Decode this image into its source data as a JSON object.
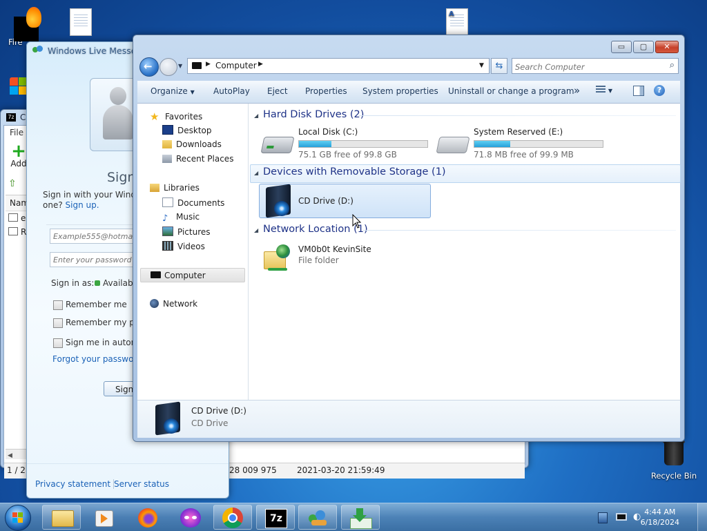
{
  "desktop": {
    "icons": [
      {
        "label": "Fire"
      },
      {
        "label": ""
      },
      {
        "label": ""
      },
      {
        "label": "Recycle Bin"
      }
    ]
  },
  "sevenzip": {
    "title": "C:",
    "menu_file": "File",
    "add_label": "Add",
    "col_name": "Nam",
    "rows": [
      "es",
      "RI"
    ],
    "status_count": "1 / 2 c",
    "status_size": "28 009 975",
    "status_date": "2021-03-20 21:59:49"
  },
  "messenger": {
    "title": "Windows Live Messenger",
    "heading": "Sign",
    "intro": "Sign in with your Windo",
    "intro2": "one?",
    "signup": "Sign up.",
    "email_placeholder": "Example555@hotmail.co",
    "password_placeholder": "Enter your password",
    "sign_in_as": "Sign in as:",
    "status": "Availabl",
    "remember_me": "Remember me",
    "remember_pass": "Remember my pass",
    "sign_auto": "Sign me in automa",
    "forgot": "Forgot your password",
    "signin_button": "Sign",
    "privacy": "Privacy statement",
    "server_status": "Server status"
  },
  "explorer": {
    "address": "Computer",
    "search_placeholder": "Search Computer",
    "toolbar": [
      "Organize",
      "AutoPlay",
      "Eject",
      "Properties",
      "System properties",
      "Uninstall or change a program"
    ],
    "overflow": "»",
    "nav": {
      "favorites": "Favorites",
      "desktop": "Desktop",
      "downloads": "Downloads",
      "recent": "Recent Places",
      "libraries": "Libraries",
      "documents": "Documents",
      "music": "Music",
      "pictures": "Pictures",
      "videos": "Videos",
      "computer": "Computer",
      "network": "Network"
    },
    "groups": {
      "hdd": "Hard Disk Drives (2)",
      "removable": "Devices with Removable Storage (1)",
      "network": "Network Location (1)"
    },
    "drives": [
      {
        "name": "Local Disk (C:)",
        "free": "75.1 GB free of 99.8 GB",
        "used_fraction": 0.25
      },
      {
        "name": "System Reserved (E:)",
        "free": "71.8 MB free of 99.9 MB",
        "used_fraction": 0.28
      }
    ],
    "cd": {
      "name": "CD Drive (D:)"
    },
    "netloc": {
      "name": "VM0b0t KevinSite",
      "type": "File folder"
    },
    "details": {
      "name": "CD Drive (D:)",
      "type": "CD Drive"
    }
  },
  "taskbar": {
    "time": "4:44 AM",
    "date": "6/18/2024",
    "apps": [
      "explorer-icon",
      "media-player-icon",
      "firefox-icon",
      "messenger-icon",
      "chrome-icon",
      "7zip-icon",
      "network-app-icon",
      "download-icon"
    ]
  },
  "colors": {
    "accent": "#26a0da",
    "group_heading": "#1e3287",
    "link": "#1b62b7"
  }
}
